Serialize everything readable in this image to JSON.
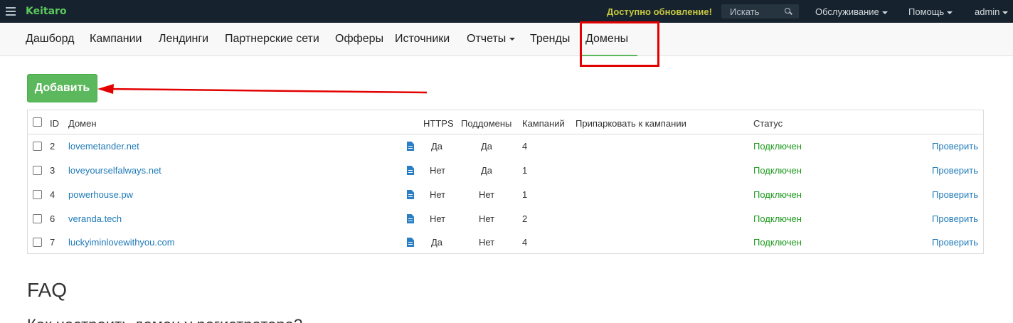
{
  "topbar": {
    "logo": "Keitaro",
    "update_notice": "Доступно обновление!",
    "search_placeholder": "Искать",
    "menus": [
      "Обслуживание",
      "Помощь",
      "admin"
    ]
  },
  "nav": {
    "items": [
      "Дашборд",
      "Кампании",
      "Лендинги",
      "Партнерские сети",
      "Офферы",
      "Источники",
      "Отчеты",
      "Тренды",
      "Домены"
    ],
    "active": "Домены"
  },
  "actions": {
    "add_label": "Добавить"
  },
  "table": {
    "headers": {
      "id": "ID",
      "domain": "Домен",
      "https": "HTTPS",
      "subdomains": "Поддомены",
      "campaigns": "Кампаний",
      "park": "Припарковать к кампании",
      "status": "Статус"
    },
    "check_label": "Проверить",
    "rows": [
      {
        "id": "2",
        "domain": "lovemetander.net",
        "https": "Да",
        "subdomains": "Да",
        "campaigns": "4",
        "status": "Подключен"
      },
      {
        "id": "3",
        "domain": "loveyourselfalways.net",
        "https": "Нет",
        "subdomains": "Да",
        "campaigns": "1",
        "status": "Подключен"
      },
      {
        "id": "4",
        "domain": "powerhouse.pw",
        "https": "Нет",
        "subdomains": "Нет",
        "campaigns": "1",
        "status": "Подключен"
      },
      {
        "id": "6",
        "domain": "veranda.tech",
        "https": "Нет",
        "subdomains": "Нет",
        "campaigns": "2",
        "status": "Подключен"
      },
      {
        "id": "7",
        "domain": "luckyiminlovewithyou.com",
        "https": "Да",
        "subdomains": "Нет",
        "campaigns": "4",
        "status": "Подключен"
      }
    ]
  },
  "faq": {
    "title": "FAQ",
    "question": "Как настроить домен у регистратора?"
  },
  "colors": {
    "topbar_bg": "#16232e",
    "brand_green": "#5cb85c",
    "update_yellow": "#c7c741",
    "link_blue": "#1f7ab8",
    "status_green": "#1f9a1f",
    "annotation_red": "#e30000"
  }
}
